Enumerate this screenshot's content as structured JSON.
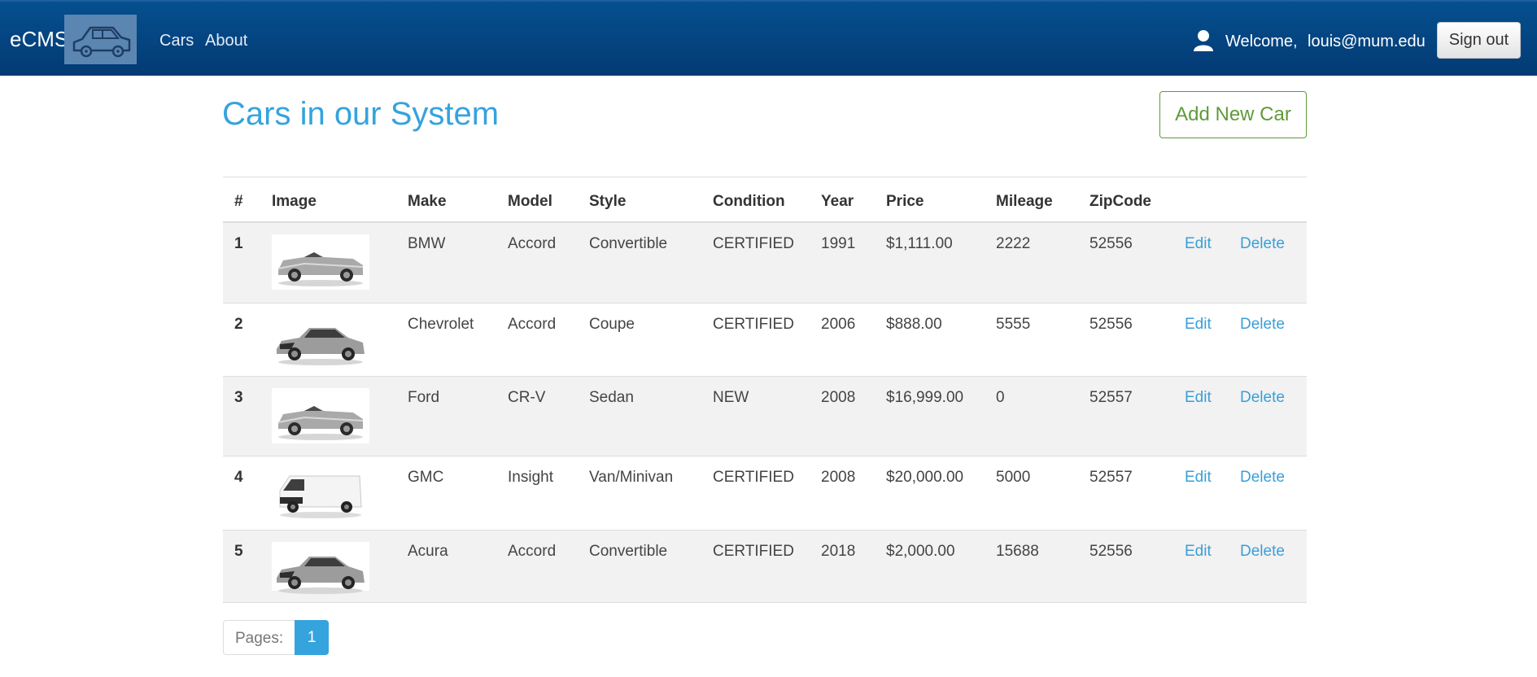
{
  "nav": {
    "brand": "eCMS",
    "links": [
      "Cars",
      "About"
    ],
    "welcome": "Welcome,",
    "user_email": "louis@mum.edu",
    "signout_label": "Sign out"
  },
  "page": {
    "title": "Cars in our System",
    "add_button": "Add New Car"
  },
  "table": {
    "headers": [
      "#",
      "Image",
      "Make",
      "Model",
      "Style",
      "Condition",
      "Year",
      "Price",
      "Mileage",
      "ZipCode"
    ],
    "rows": [
      {
        "num": "1",
        "image": "convertible-car-image",
        "make": "BMW",
        "model": "Accord",
        "style": "Convertible",
        "condition": "CERTIFIED",
        "year": "1991",
        "price": "$1,111.00",
        "mileage": "2222",
        "zip": "52556",
        "edit": "Edit",
        "delete": "Delete"
      },
      {
        "num": "2",
        "image": "sedan-car-image",
        "make": "Chevrolet",
        "model": "Accord",
        "style": "Coupe",
        "condition": "CERTIFIED",
        "year": "2006",
        "price": "$888.00",
        "mileage": "5555",
        "zip": "52556",
        "edit": "Edit",
        "delete": "Delete"
      },
      {
        "num": "3",
        "image": "convertible-car-image",
        "make": "Ford",
        "model": "CR-V",
        "style": "Sedan",
        "condition": "NEW",
        "year": "2008",
        "price": "$16,999.00",
        "mileage": "0",
        "zip": "52557",
        "edit": "Edit",
        "delete": "Delete"
      },
      {
        "num": "4",
        "image": "van-image",
        "make": "GMC",
        "model": "Insight",
        "style": "Van/Minivan",
        "condition": "CERTIFIED",
        "year": "2008",
        "price": "$20,000.00",
        "mileage": "5000",
        "zip": "52557",
        "edit": "Edit",
        "delete": "Delete"
      },
      {
        "num": "5",
        "image": "sedan-car-image",
        "make": "Acura",
        "model": "Accord",
        "style": "Convertible",
        "condition": "CERTIFIED",
        "year": "2018",
        "price": "$2,000.00",
        "mileage": "15688",
        "zip": "52556",
        "edit": "Edit",
        "delete": "Delete"
      }
    ]
  },
  "pagination": {
    "label": "Pages:",
    "current": "1"
  },
  "colors": {
    "navbar": "#033f7d",
    "title": "#35a3dd",
    "add_button": "#5f9a3b",
    "link": "#3a9fd7",
    "row_stripe": "#f2f2f2"
  }
}
